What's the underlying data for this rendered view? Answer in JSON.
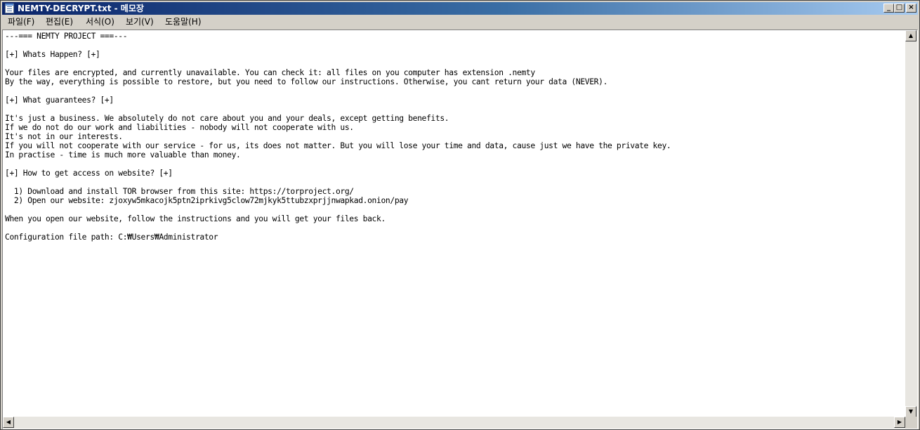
{
  "window": {
    "title": "NEMTY-DECRYPT.txt - 메모장",
    "minimize_glyph": "_",
    "maximize_glyph": "□",
    "close_glyph": "×"
  },
  "menu": {
    "items": [
      {
        "label": "파일(F)"
      },
      {
        "label": "편집(E)"
      },
      {
        "label": "서식(O)"
      },
      {
        "label": "보기(V)"
      },
      {
        "label": "도움말(H)"
      }
    ]
  },
  "document": {
    "lines": [
      "---=== NEMTY PROJECT ===---",
      "",
      "[+] Whats Happen? [+]",
      "",
      "Your files are encrypted, and currently unavailable. You can check it: all files on you computer has extension .nemty",
      "By the way, everything is possible to restore, but you need to follow our instructions. Otherwise, you cant return your data (NEVER).",
      "",
      "[+] What guarantees? [+]",
      "",
      "It's just a business. We absolutely do not care about you and your deals, except getting benefits.",
      "If we do not do our work and liabilities - nobody will not cooperate with us.",
      "It's not in our interests.",
      "If you will not cooperate with our service - for us, its does not matter. But you will lose your time and data, cause just we have the private key.",
      "In practise - time is much more valuable than money.",
      "",
      "[+] How to get access on website? [+]",
      "",
      "  1) Download and install TOR browser from this site: https://torproject.org/",
      "  2) Open our website: zjoxyw5mkacojk5ptn2iprkivg5clow72mjkyk5ttubzxprjjnwapkad.onion/pay",
      "",
      "When you open our website, follow the instructions and you will get your files back.",
      "",
      "Configuration file path: C:₩Users₩Administrator"
    ]
  },
  "scrollbar": {
    "up_glyph": "▲",
    "down_glyph": "▼",
    "left_glyph": "◀",
    "right_glyph": "▶"
  }
}
